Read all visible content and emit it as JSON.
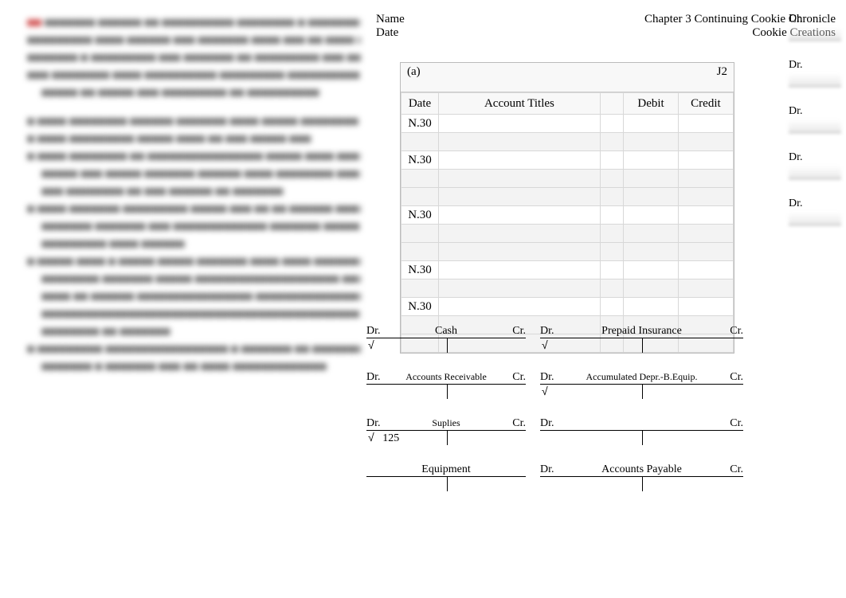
{
  "header": {
    "name_label": "Name",
    "date_label": "Date",
    "chapter_title": "Chapter 3 Continuing Cookie Chronicle",
    "company": "Cookie Creations"
  },
  "journal": {
    "tag": "(a)",
    "page": "J2",
    "cols": {
      "date": "Date",
      "titles": "Account Titles",
      "debit": "Debit",
      "credit": "Credit"
    },
    "date_entries": [
      "N.30",
      "N.30",
      "N.30",
      "N.30",
      "N.30"
    ]
  },
  "taccounts": {
    "cash": {
      "title": "Cash",
      "dr": "Dr.",
      "cr": "Cr.",
      "check": true
    },
    "ar": {
      "title": "Accounts Receivable",
      "dr": "Dr.",
      "cr": "Cr."
    },
    "supplies": {
      "title": "Suplies",
      "dr": "Dr.",
      "cr": "Cr.",
      "check": true,
      "amt": "125"
    },
    "equipment": {
      "title": "Equipment"
    },
    "ppdins": {
      "title": "Prepaid Insurance",
      "dr": "Dr.",
      "cr": "Cr.",
      "check": true
    },
    "accdep": {
      "title": "Accumulated Depr.-B.Equip.",
      "dr": "Dr.",
      "cr": "Cr.",
      "check": true
    },
    "blank": {
      "title": "",
      "dr": "Dr.",
      "cr": "Cr."
    },
    "ap": {
      "title": "Accounts Payable",
      "dr": "Dr.",
      "cr": "Cr."
    }
  },
  "right_stubs": {
    "label": "Dr."
  }
}
